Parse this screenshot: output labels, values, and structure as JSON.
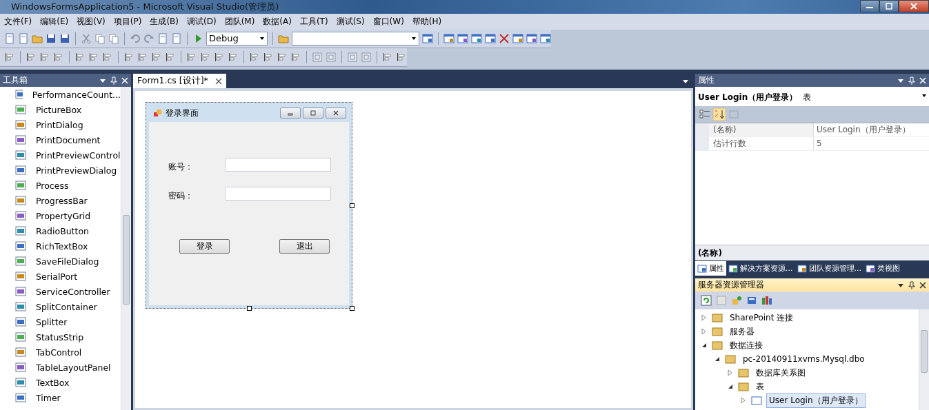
{
  "window": {
    "title": "WindowsFormsApplication5 - Microsoft Visual Studio(管理员)"
  },
  "menu": [
    "文件(F)",
    "编辑(E)",
    "视图(V)",
    "项目(P)",
    "生成(B)",
    "调试(D)",
    "团队(M)",
    "数据(A)",
    "工具(T)",
    "测试(S)",
    "窗口(W)",
    "帮助(H)"
  ],
  "toolbar": {
    "configuration": "Debug"
  },
  "toolbox": {
    "title": "工具箱",
    "items": [
      {
        "label": "PerformanceCount..."
      },
      {
        "label": "PictureBox"
      },
      {
        "label": "PrintDialog"
      },
      {
        "label": "PrintDocument"
      },
      {
        "label": "PrintPreviewControl"
      },
      {
        "label": "PrintPreviewDialog"
      },
      {
        "label": "Process"
      },
      {
        "label": "ProgressBar"
      },
      {
        "label": "PropertyGrid"
      },
      {
        "label": "RadioButton"
      },
      {
        "label": "RichTextBox"
      },
      {
        "label": "SaveFileDialog"
      },
      {
        "label": "SerialPort"
      },
      {
        "label": "ServiceController"
      },
      {
        "label": "SplitContainer"
      },
      {
        "label": "Splitter"
      },
      {
        "label": "StatusStrip"
      },
      {
        "label": "TabControl"
      },
      {
        "label": "TableLayoutPanel"
      },
      {
        "label": "TextBox"
      },
      {
        "label": "Timer"
      }
    ]
  },
  "document_tabs": [
    {
      "label": "Form1.cs [设计]*",
      "selected": true
    }
  ],
  "form": {
    "title": "登录界面",
    "fields": [
      {
        "label": "账号："
      },
      {
        "label": "密码："
      }
    ],
    "buttons": [
      "登录",
      "退出"
    ]
  },
  "properties": {
    "title": "属性",
    "object": "User Login（用户登录）",
    "object_type": "表",
    "rows": [
      {
        "name": "(名称)",
        "value": "User Login（用户登录）"
      },
      {
        "name": "估计行数",
        "value": "5"
      }
    ],
    "description_title": "(名称)",
    "tabs": [
      {
        "label": "属性",
        "selected": true
      },
      {
        "label": "解决方案资源...",
        "selected": false
      },
      {
        "label": "团队资源管理...",
        "selected": false
      },
      {
        "label": "类视图",
        "selected": false
      }
    ]
  },
  "server_explorer": {
    "title": "服务器资源管理器",
    "tree": [
      {
        "label": "SharePoint 连接",
        "expanded": false,
        "selected": false
      },
      {
        "label": "服务器",
        "expanded": false,
        "selected": false
      },
      {
        "label": "数据连接",
        "expanded": true,
        "selected": false,
        "children": [
          {
            "label": "pc-20140911xvms.Mysql.dbo",
            "expanded": true,
            "selected": false,
            "children": [
              {
                "label": "数据库关系图",
                "expanded": false,
                "selected": false
              },
              {
                "label": "表",
                "expanded": true,
                "selected": false,
                "children": [
                  {
                    "label": "User Login（用户登录）",
                    "expanded": false,
                    "selected": true
                  }
                ]
              }
            ]
          }
        ]
      }
    ]
  }
}
